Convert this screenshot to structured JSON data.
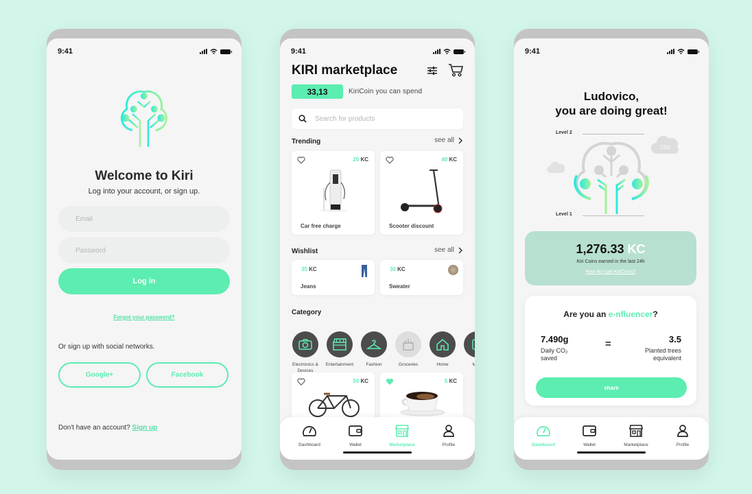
{
  "colors": {
    "background": "#d3f6ea",
    "accent": "#5cedb1",
    "kc_card": "#b7e0d0"
  },
  "status_bar": {
    "time": "9:41"
  },
  "login": {
    "title": "Welcome to Kiri",
    "subtitle": "Log into your account, or sign up.",
    "email_placeholder": "Email",
    "password_placeholder": "Password",
    "login_button": "Log in",
    "forgot_link": "Forgot your password?",
    "social_label": "Or sign up with social networks.",
    "google_button": "Google+",
    "facebook_button": "Facebook",
    "no_account_text": "Don't have an account?",
    "signup_link": "Sign up"
  },
  "marketplace": {
    "title": "KIRI marketplace",
    "coin_balance": "33,13",
    "coin_label": "KiriCoin you can spend",
    "search_placeholder": "Search for products",
    "trending_title": "Trending",
    "wishlist_title": "Wishlist",
    "category_title": "Category",
    "see_all": "see all",
    "currency": "KC",
    "trending": [
      {
        "price": "20",
        "name": "Car free charge",
        "liked": false
      },
      {
        "price": "40",
        "name": "Scooter discount",
        "liked": false
      }
    ],
    "wishlist": [
      {
        "price": "35",
        "name": "Jeans"
      },
      {
        "price": "30",
        "name": "Sweater"
      }
    ],
    "categories": [
      {
        "label": "Electronics & Devices",
        "icon": "camera-icon"
      },
      {
        "label": "Entertainment",
        "icon": "clapperboard-icon"
      },
      {
        "label": "Fashion",
        "icon": "hanger-icon"
      },
      {
        "label": "Groceries",
        "icon": "grocery-bag-icon"
      },
      {
        "label": "Home",
        "icon": "home-icon"
      },
      {
        "label": "Mob",
        "icon": "mobility-icon"
      }
    ],
    "more_products": [
      {
        "price": "50",
        "name": "Bicycle",
        "liked": false
      },
      {
        "price": "5",
        "name": "Coffee",
        "liked": true
      }
    ]
  },
  "dashboard": {
    "greeting_line1": "Ludovico,",
    "greeting_line2": "you are doing great!",
    "level_top": "Level 2",
    "level_bottom": "Level 1",
    "co2_label": "CO2",
    "kc_amount": "1,276.33",
    "kc_unit": "KC",
    "kc_desc": "Kiri Coins earned in the last 24h",
    "kc_link": "How do I get KiriCoins?",
    "influencer_prefix": "Are you an ",
    "influencer_highlight": "e-nfluencer",
    "influencer_suffix": "?",
    "co2_value": "7.490g",
    "co2_stat_line1": "Daily CO₂",
    "co2_stat_line2": "saved",
    "equals": "=",
    "trees_value": "3.5",
    "trees_line1": "Planted trees",
    "trees_line2": "equivalent",
    "share_button": "share"
  },
  "tabbar": [
    {
      "label": "Dashboard",
      "icon": "gauge-icon"
    },
    {
      "label": "Wallet",
      "icon": "wallet-icon"
    },
    {
      "label": "Marketplace",
      "icon": "store-icon"
    },
    {
      "label": "Profile",
      "icon": "profile-icon"
    }
  ],
  "tabbar_active": {
    "marketplace_screen": "Marketplace",
    "dashboard_screen": "Dashboard"
  }
}
